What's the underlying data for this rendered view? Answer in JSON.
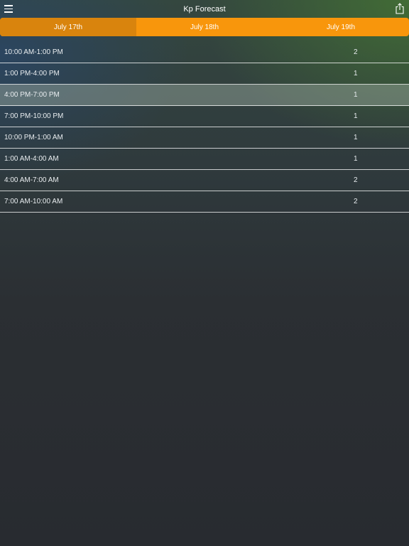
{
  "header": {
    "title": "Kp Forecast",
    "menu_icon": "hamburger-menu-icon",
    "share_icon": "share-icon"
  },
  "tabs": [
    {
      "label": "July 17th",
      "selected": true
    },
    {
      "label": "July 18th",
      "selected": false
    },
    {
      "label": "July 19th",
      "selected": false
    }
  ],
  "forecast": [
    {
      "time": "10:00 AM-1:00 PM",
      "kp": "2"
    },
    {
      "time": "1:00 PM-4:00 PM",
      "kp": "1"
    },
    {
      "time": "4:00 PM-7:00 PM",
      "kp": "1",
      "highlighted": true
    },
    {
      "time": "7:00 PM-10:00 PM",
      "kp": "1"
    },
    {
      "time": "10:00 PM-1:00 AM",
      "kp": "1"
    },
    {
      "time": "1:00 AM-4:00 AM",
      "kp": "1"
    },
    {
      "time": "4:00 AM-7:00 AM",
      "kp": "2"
    },
    {
      "time": "7:00 AM-10:00 AM",
      "kp": "2"
    }
  ],
  "colors": {
    "accent": "#f8960c",
    "accent_selected": "#d9840d"
  }
}
